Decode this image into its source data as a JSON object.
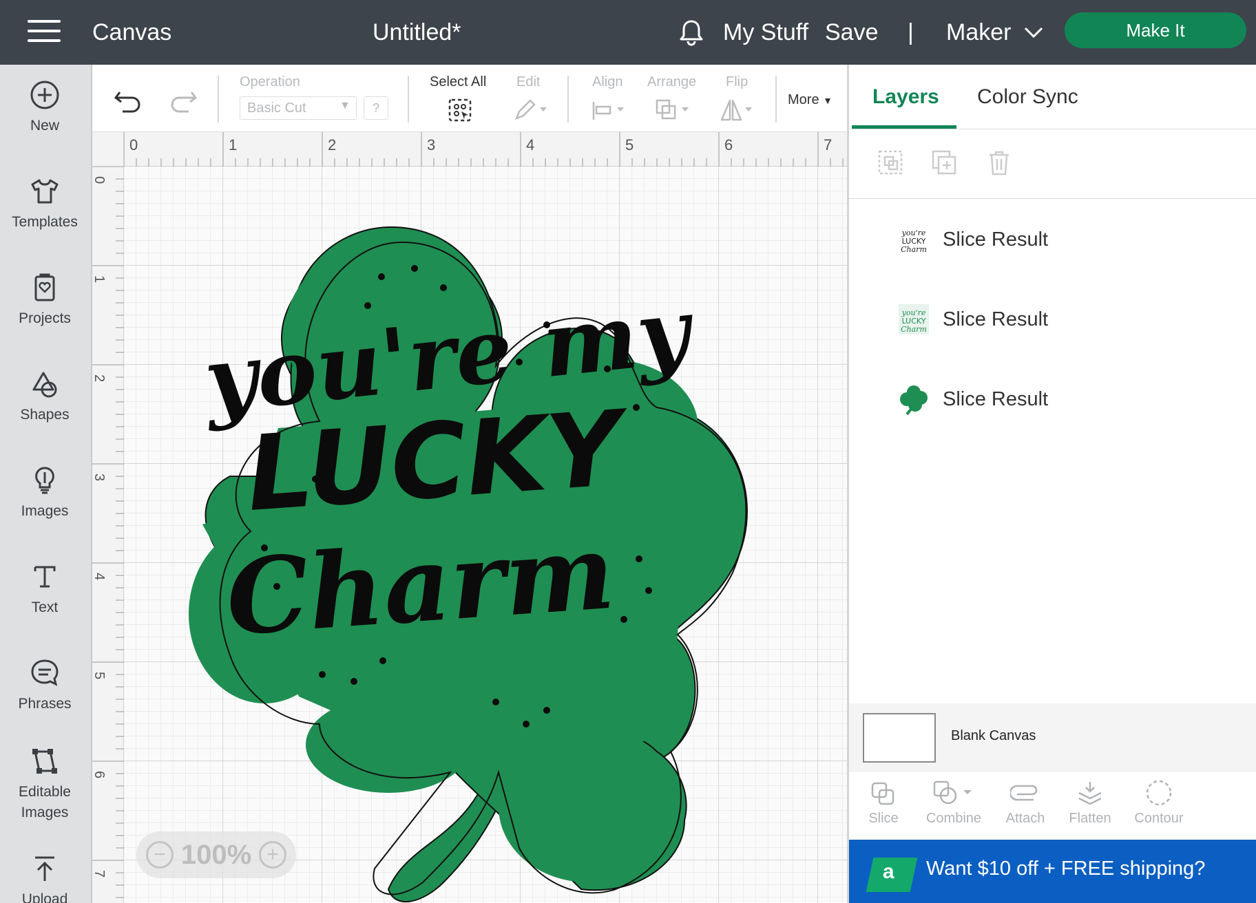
{
  "header": {
    "app_name": "Canvas",
    "doc_title": "Untitled*",
    "my_stuff": "My Stuff",
    "save": "Save",
    "separator": "|",
    "machine": "Maker",
    "make_it": "Make It"
  },
  "sidebar": {
    "items": [
      {
        "label": "New",
        "icon": "plus-circle-icon"
      },
      {
        "label": "Templates",
        "icon": "tshirt-icon"
      },
      {
        "label": "Projects",
        "icon": "projects-icon"
      },
      {
        "label": "Shapes",
        "icon": "shapes-icon"
      },
      {
        "label": "Images",
        "icon": "lightbulb-icon"
      },
      {
        "label": "Text",
        "icon": "text-icon"
      },
      {
        "label": "Phrases",
        "icon": "speech-bubble-icon"
      },
      {
        "label": "Editable Images",
        "line1": "Editable",
        "line2": "Images",
        "icon": "editable-image-icon"
      },
      {
        "label": "Upload",
        "icon": "upload-icon"
      }
    ]
  },
  "toolbar": {
    "operation_label": "Operation",
    "operation_value": "Basic Cut",
    "help": "?",
    "select_all": "Select All",
    "edit": "Edit",
    "align": "Align",
    "arrange": "Arrange",
    "flip": "Flip",
    "more": "More"
  },
  "canvas": {
    "ruler_top": [
      "0",
      "1",
      "2",
      "3",
      "4",
      "5",
      "6",
      "7"
    ],
    "ruler_left": [
      "0",
      "1",
      "2",
      "3",
      "4",
      "5",
      "6",
      "7"
    ],
    "zoom": "100%",
    "artwork": {
      "line1": "you're my",
      "line2": "LUCKY",
      "line3": "Charm",
      "fill_color": "#1f8e52",
      "text_color": "#0b0b0b"
    }
  },
  "panel": {
    "tabs": [
      "Layers",
      "Color Sync"
    ],
    "active_tab": "Layers",
    "layers": [
      {
        "name": "Slice Result",
        "thumb": "text-slice"
      },
      {
        "name": "Slice Result",
        "thumb": "green-text-slice"
      },
      {
        "name": "Slice Result",
        "thumb": "shamrock-slice"
      }
    ],
    "blank_canvas": "Blank Canvas",
    "tools": [
      "Slice",
      "Combine",
      "Attach",
      "Flatten",
      "Contour"
    ],
    "promo": "Want $10 off + FREE shipping?",
    "promo_logo": "a"
  },
  "colors": {
    "topbar": "#3d444b",
    "accent": "#128555",
    "promo": "#0b5fc2"
  }
}
